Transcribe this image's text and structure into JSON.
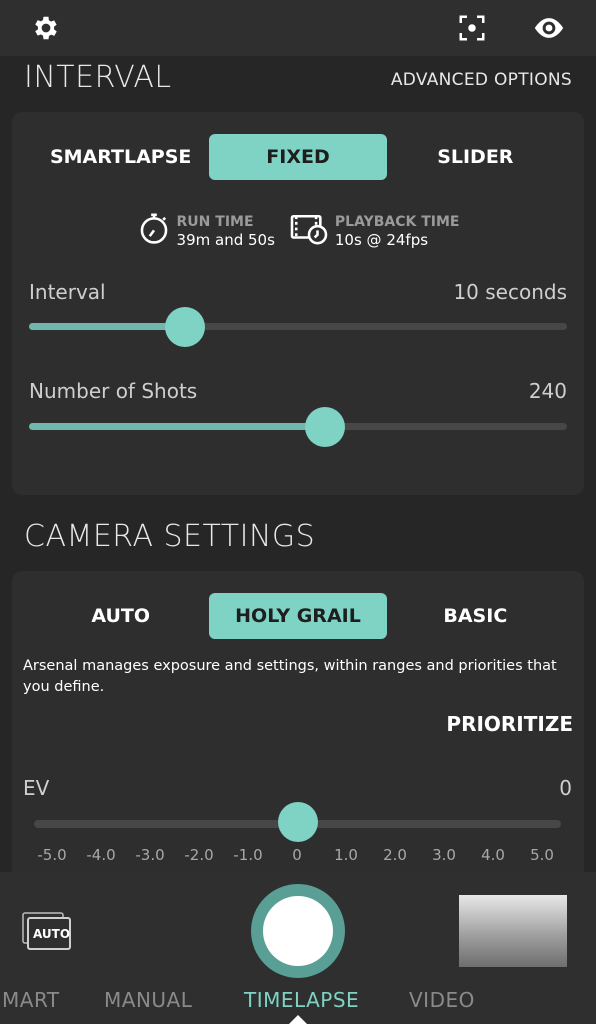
{
  "top_bar": {
    "left_icon": "gear-icon",
    "right_icons": [
      "focus-frame-icon",
      "eye-icon"
    ]
  },
  "interval_section": {
    "title": "INTERVAL",
    "advanced_options": "ADVANCED OPTIONS",
    "modes": [
      "SMARTLAPSE",
      "FIXED",
      "SLIDER"
    ],
    "active_mode": "FIXED",
    "run_time": {
      "label": "RUN TIME",
      "value": "39m and 50s"
    },
    "playback_time": {
      "label": "PLAYBACK TIME",
      "value": "10s @ 24fps"
    },
    "interval_slider": {
      "label": "Interval",
      "value": "10 seconds",
      "level": 0.29
    },
    "shots_slider": {
      "label": "Number of Shots",
      "value": "240",
      "level": 0.55
    }
  },
  "camera_section": {
    "title": "CAMERA SETTINGS",
    "modes": [
      "AUTO",
      "HOLY GRAIL",
      "BASIC"
    ],
    "active_mode": "HOLY GRAIL",
    "description": "Arsenal manages exposure and settings, within ranges and priorities that you define.",
    "prioritize": "PRIORITIZE",
    "ev": {
      "label": "EV",
      "value": "0",
      "ticks": [
        "-5.0",
        "-4.0",
        "-3.0",
        "-2.0",
        "-1.0",
        "0",
        "1.0",
        "2.0",
        "3.0",
        "4.0",
        "5.0"
      ]
    }
  },
  "bottom_bar": {
    "auto_badge": "AUTO",
    "modes": [
      "MART",
      "MANUAL",
      "TIMELAPSE",
      "VIDEO"
    ],
    "active_mode": "TIMELAPSE"
  },
  "colors": {
    "accent": "#7ed3c5",
    "background": "#262626",
    "card": "#2e2e2e"
  }
}
